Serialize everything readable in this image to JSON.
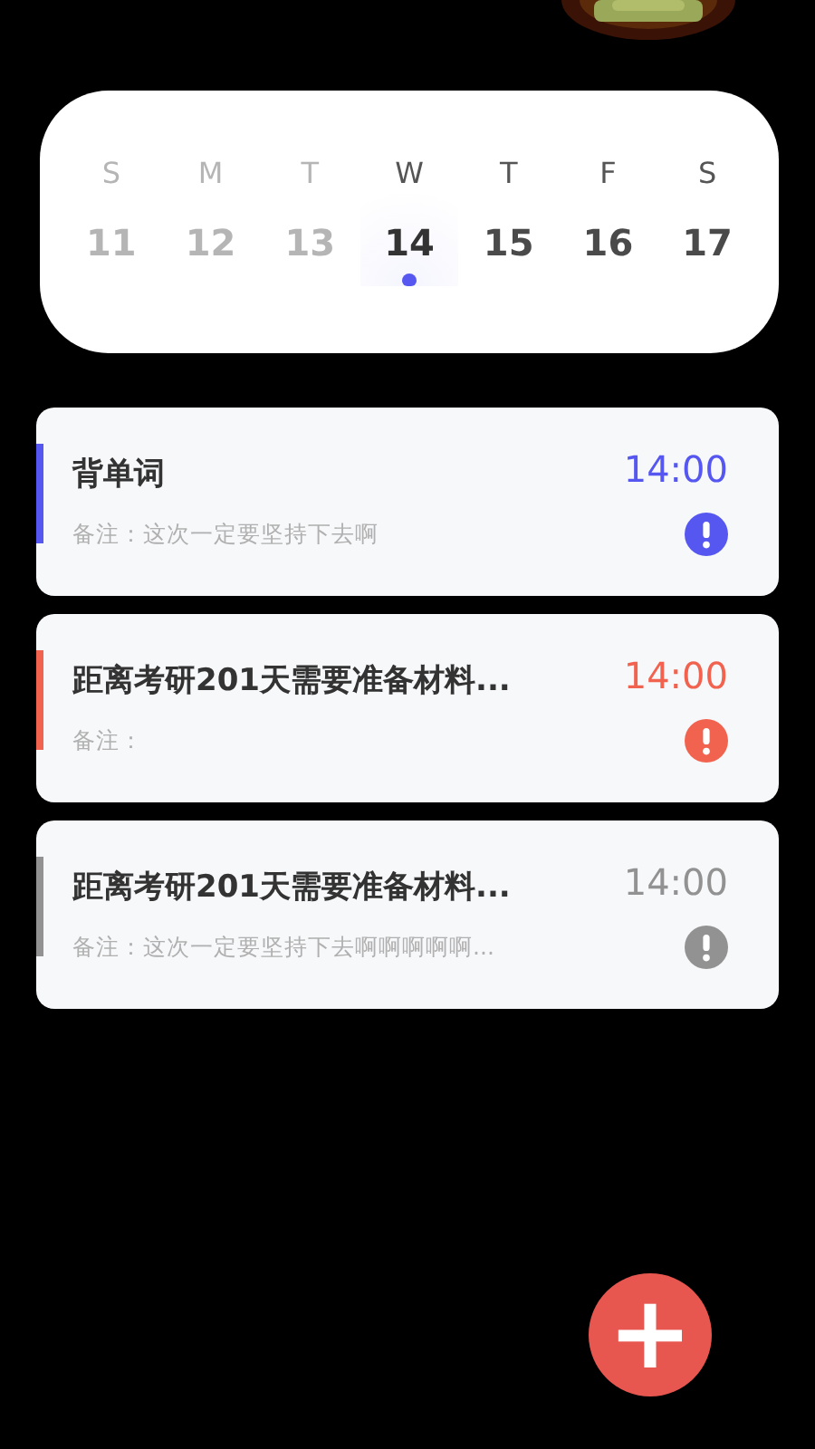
{
  "week": {
    "days": [
      {
        "weekday": "S",
        "date": "11",
        "past": true,
        "selected": false
      },
      {
        "weekday": "M",
        "date": "12",
        "past": true,
        "selected": false
      },
      {
        "weekday": "T",
        "date": "13",
        "past": true,
        "selected": false
      },
      {
        "weekday": "W",
        "date": "14",
        "past": false,
        "selected": true
      },
      {
        "weekday": "T",
        "date": "15",
        "past": false,
        "selected": false
      },
      {
        "weekday": "F",
        "date": "16",
        "past": false,
        "selected": false
      },
      {
        "weekday": "S",
        "date": "17",
        "past": false,
        "selected": false
      }
    ]
  },
  "tasks": [
    {
      "title": "背单词",
      "note": "备注：这次一定要坚持下去啊",
      "time": "14:00",
      "color": "#5557f0"
    },
    {
      "title": "距离考研201天需要准备材料...",
      "note": "备注：",
      "time": "14:00",
      "color": "#f2634f"
    },
    {
      "title": "距离考研201天需要准备材料...",
      "note": "备注：这次一定要坚持下去啊啊啊啊啊...",
      "time": "14:00",
      "color": "#929292"
    }
  ],
  "add_button": {
    "label": "+"
  }
}
